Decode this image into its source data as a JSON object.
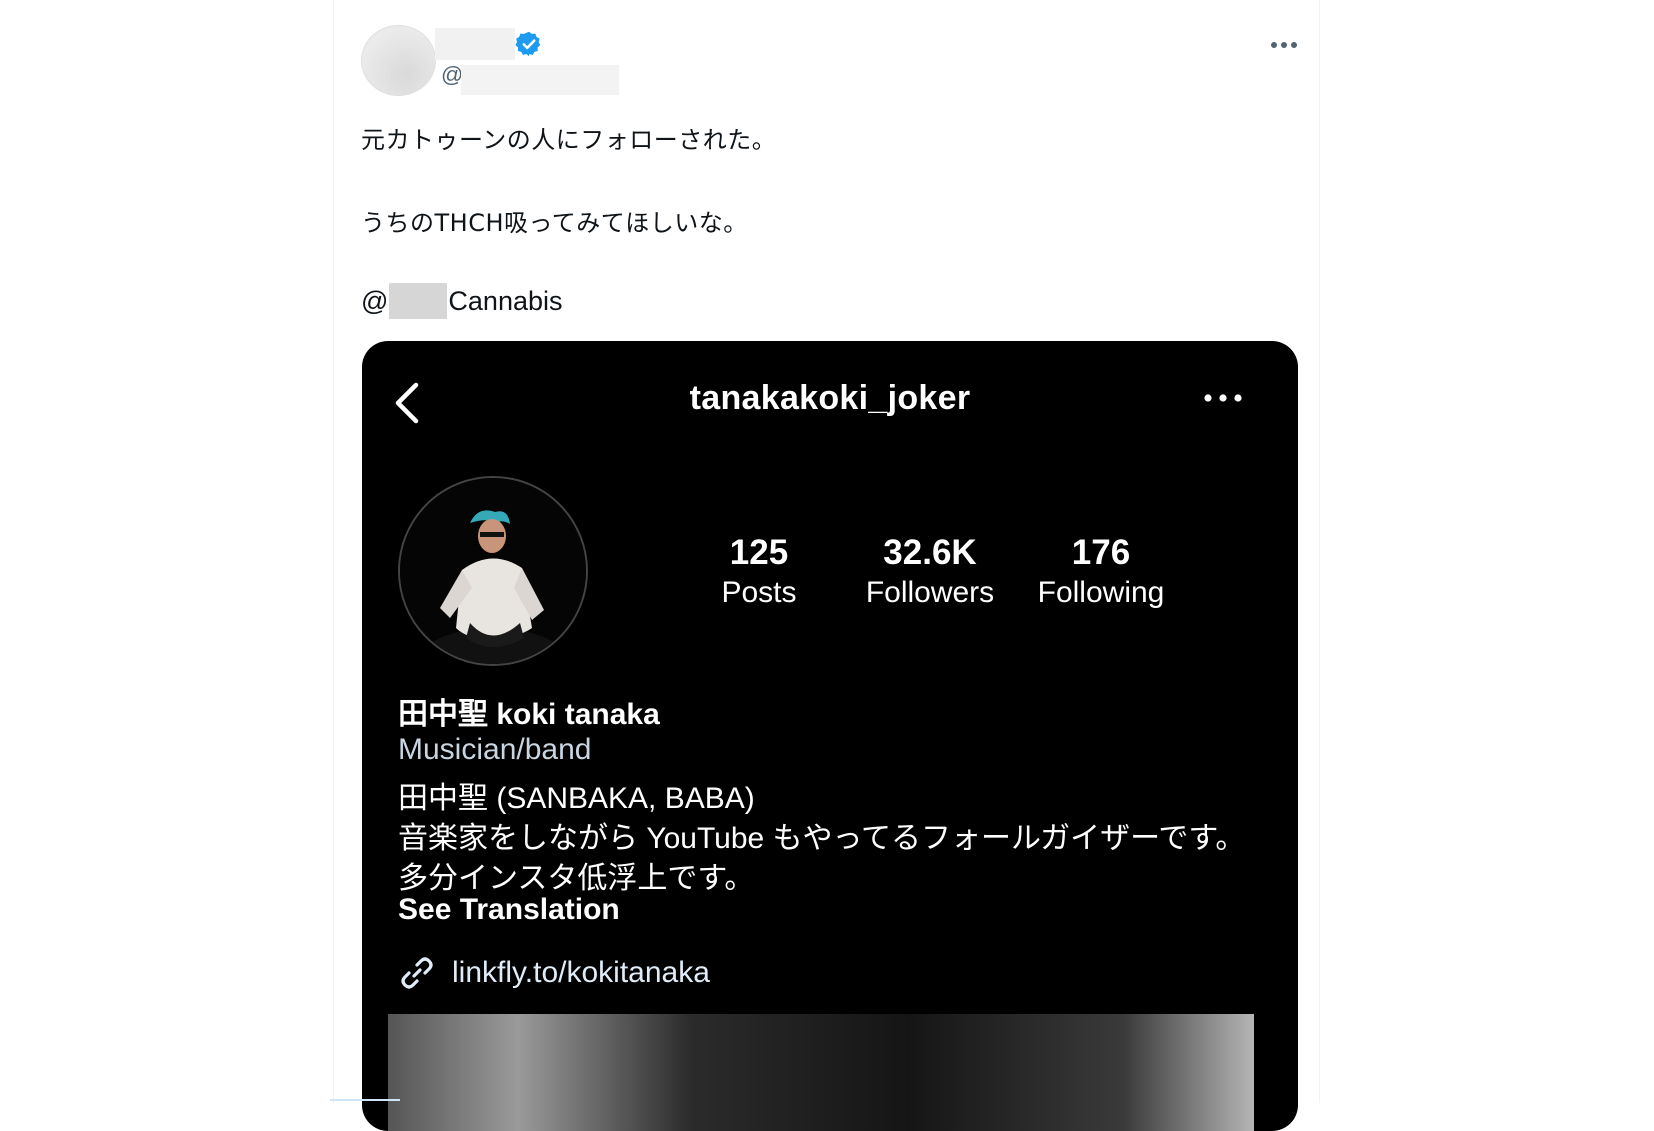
{
  "tweet": {
    "handle_prefix": "@",
    "more_icon": "more-horizontal-icon",
    "verified_icon": "verified-badge-icon",
    "verified_color": "#1d9bf0",
    "lines": [
      "元カトゥーンの人にフォローされた。",
      "うちのTHCH吸ってみてほしいな。"
    ],
    "mention_prefix": "@",
    "mention_suffix": "Cannabis"
  },
  "instagram": {
    "username": "tanakakoki_joker",
    "back_icon": "chevron-left-icon",
    "more_icon": "more-horizontal-icon",
    "stats": [
      {
        "value": "125",
        "label": "Posts"
      },
      {
        "value": "32.6K",
        "label": "Followers"
      },
      {
        "value": "176",
        "label": "Following"
      }
    ],
    "display_name": "田中聖 koki tanaka",
    "category": "Musician/band",
    "bio": [
      "田中聖 (SANBAKA, BABA)",
      "音楽家をしながら YouTube もやってるフォールガイザーです。",
      "多分インスタ低浮上です。"
    ],
    "see_translation": "See Translation",
    "link_icon": "link-icon",
    "link": "linkfly.to/kokitanaka"
  }
}
